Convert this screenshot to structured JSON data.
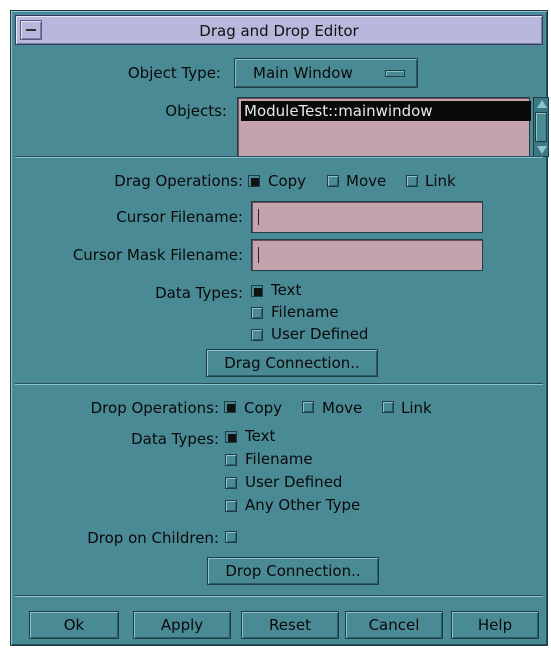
{
  "window": {
    "title": "Drag and Drop Editor"
  },
  "object_type": {
    "label": "Object Type:",
    "value": "Main Window"
  },
  "objects": {
    "label": "Objects:",
    "items": [
      "ModuleTest::mainwindow"
    ]
  },
  "drag": {
    "operations_label": "Drag Operations:",
    "operations": [
      {
        "label": "Copy",
        "checked": true
      },
      {
        "label": "Move",
        "checked": false
      },
      {
        "label": "Link",
        "checked": false
      }
    ],
    "cursor_filename_label": "Cursor Filename:",
    "cursor_filename_value": "",
    "cursor_mask_label": "Cursor Mask Filename:",
    "cursor_mask_value": "",
    "data_types_label": "Data Types:",
    "data_types": [
      {
        "label": "Text",
        "checked": true
      },
      {
        "label": "Filename",
        "checked": false
      },
      {
        "label": "User Defined",
        "checked": false
      }
    ],
    "connection_button": "Drag Connection.."
  },
  "drop": {
    "operations_label": "Drop Operations:",
    "operations": [
      {
        "label": "Copy",
        "checked": true
      },
      {
        "label": "Move",
        "checked": false
      },
      {
        "label": "Link",
        "checked": false
      }
    ],
    "data_types_label": "Data Types:",
    "data_types": [
      {
        "label": "Text",
        "checked": true
      },
      {
        "label": "Filename",
        "checked": false
      },
      {
        "label": "User Defined",
        "checked": false
      },
      {
        "label": "Any Other Type",
        "checked": false
      }
    ],
    "children_label": "Drop on Children:",
    "children_checked": false,
    "connection_button": "Drop Connection.."
  },
  "buttons": {
    "ok": "Ok",
    "apply": "Apply",
    "reset": "Reset",
    "cancel": "Cancel",
    "help": "Help"
  },
  "colors": {
    "background": "#4a8a95",
    "field": "#c4a2ae",
    "title": "#b8b8dc"
  }
}
